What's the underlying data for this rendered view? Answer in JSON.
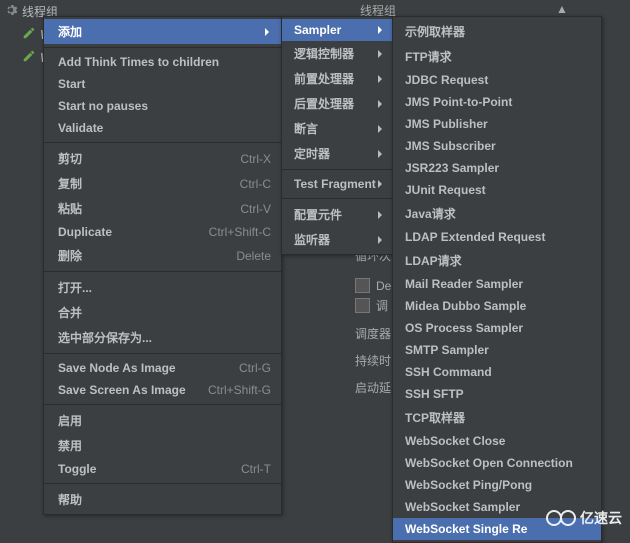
{
  "header": {
    "col1": "线程组",
    "col2": "▲"
  },
  "tree": {
    "node1_label": "线程组",
    "node2_label": "W",
    "node3_label": "W"
  },
  "bg_partial": {
    "row1": "De",
    "row2": "调",
    "label1": "调度器",
    "label2": "持续时",
    "label3": "启动延",
    "misc": "循环次"
  },
  "menu1": {
    "add": "添加",
    "think": "Add Think Times to children",
    "start": "Start",
    "startnp": "Start no pauses",
    "validate": "Validate",
    "cut": "剪切",
    "cut_sc": "Ctrl-X",
    "copy": "复制",
    "copy_sc": "Ctrl-C",
    "paste": "粘贴",
    "paste_sc": "Ctrl-V",
    "dup": "Duplicate",
    "dup_sc": "Ctrl+Shift-C",
    "del": "删除",
    "del_sc": "Delete",
    "open": "打开...",
    "merge": "合并",
    "savesel": "选中部分保存为...",
    "savenode": "Save Node As Image",
    "savenode_sc": "Ctrl-G",
    "savescr": "Save Screen As Image",
    "savescr_sc": "Ctrl+Shift-G",
    "enable": "启用",
    "disable": "禁用",
    "toggle": "Toggle",
    "toggle_sc": "Ctrl-T",
    "help": "帮助"
  },
  "menu2": {
    "sampler": "Sampler",
    "logic": "逻辑控制器",
    "pre": "前置处理器",
    "post": "后置处理器",
    "assert": "断言",
    "timer": "定时器",
    "tf": "Test Fragment",
    "cfg": "配置元件",
    "listener": "监听器"
  },
  "menu3": {
    "i1": "示例取样器",
    "i2": "FTP请求",
    "i3": "JDBC Request",
    "i4": "JMS Point-to-Point",
    "i5": "JMS Publisher",
    "i6": "JMS Subscriber",
    "i7": "JSR223 Sampler",
    "i8": "JUnit Request",
    "i9": "Java请求",
    "i10": "LDAP Extended Request",
    "i11": "LDAP请求",
    "i12": "Mail Reader Sampler",
    "i13": "Midea Dubbo Sample",
    "i14": "OS Process Sampler",
    "i15": "SMTP Sampler",
    "i16": "SSH Command",
    "i17": "SSH SFTP",
    "i18": "TCP取样器",
    "i19": "WebSocket Close",
    "i20": "WebSocket Open Connection",
    "i21": "WebSocket Ping/Pong",
    "i22": "WebSocket Sampler",
    "i23": "WebSocket Single Re"
  },
  "watermark": "亿速云"
}
